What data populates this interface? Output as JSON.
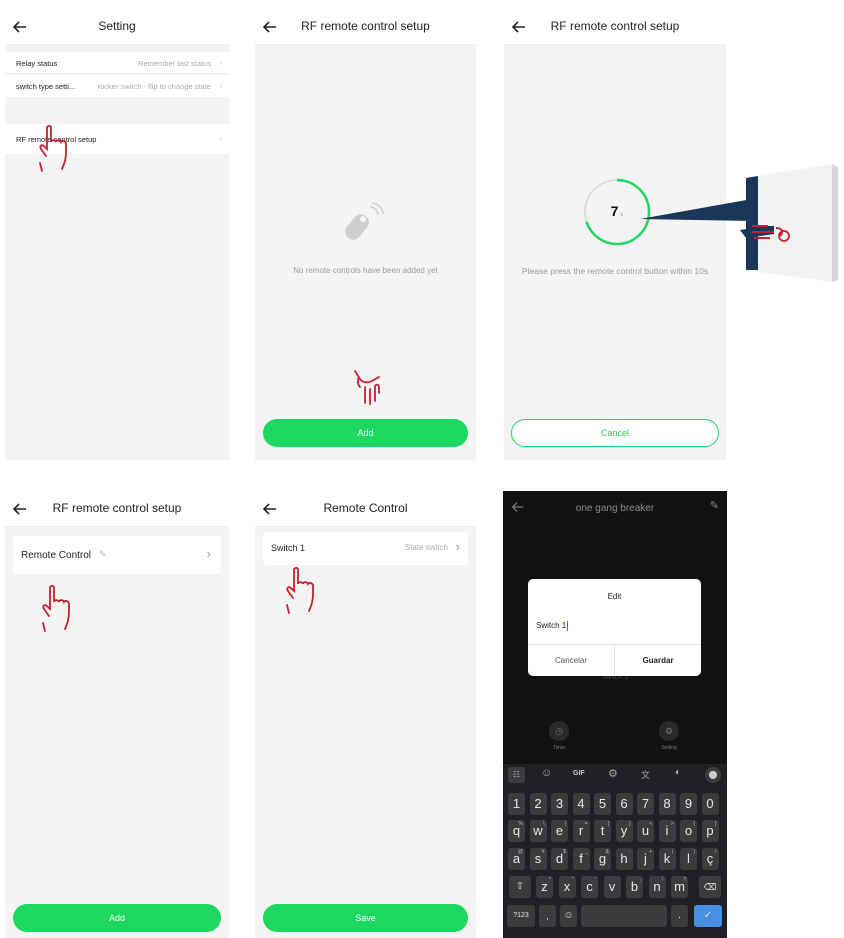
{
  "panel1": {
    "title": "Setting",
    "rows": [
      {
        "label": "Relay status",
        "value": "Remember last status"
      },
      {
        "label": "switch type setti...",
        "value": "rocker switch - flip to change state"
      },
      {
        "label": "RF remote control setup",
        "value": ""
      }
    ]
  },
  "panel2": {
    "title": "RF remote control setup",
    "empty_text": "No remote controls have been added yet",
    "add_label": "Add"
  },
  "panel3": {
    "title": "RF remote control setup",
    "countdown_value": "7",
    "countdown_unit": "s",
    "countdown_fraction": 0.7,
    "instruction": "Please press the remote control button within 10s",
    "cancel_label": "Cancel"
  },
  "panel4": {
    "title": "RF remote control setup",
    "item_label": "Remote Control",
    "add_label": "Add"
  },
  "panel5": {
    "title": "Remote Control",
    "item_label": "Switch 1",
    "item_value": "State switch",
    "save_label": "Save"
  },
  "panel6": {
    "title": "one gang breaker",
    "bg_label": "Switch 1",
    "dialog_title": "Edit",
    "input_value": "Switch 1",
    "cancel_label": "Cancelar",
    "save_label": "Guardar",
    "timer_label": "Timer",
    "setting_label": "Setting",
    "keyboard": {
      "toolbar_gif": "GIF",
      "numbers": [
        "1",
        "2",
        "3",
        "4",
        "5",
        "6",
        "7",
        "8",
        "9",
        "0"
      ],
      "row1": [
        "q",
        "w",
        "e",
        "r",
        "t",
        "y",
        "u",
        "i",
        "o",
        "p"
      ],
      "row1_hints": [
        "%",
        "\\",
        "|",
        "=",
        "[",
        "]",
        "<",
        ">",
        "{",
        "}"
      ],
      "row2": [
        "a",
        "s",
        "d",
        "f",
        "g",
        "h",
        "j",
        "k",
        "l",
        "ç"
      ],
      "row2_hints": [
        "@",
        "#",
        "$",
        "_",
        "&",
        "-",
        "+",
        "(",
        ")",
        "/"
      ],
      "row3": [
        "z",
        "x",
        "c",
        "v",
        "b",
        "n",
        "m"
      ],
      "row3_hints": [
        "*",
        "\"",
        "'",
        ":",
        ";",
        "!",
        "?"
      ],
      "sym_label": "?123",
      "comma": ",",
      "period": "."
    }
  },
  "colors": {
    "accent": "#1ed760",
    "hand": "#c8202f",
    "dark_bg": "#121212"
  }
}
